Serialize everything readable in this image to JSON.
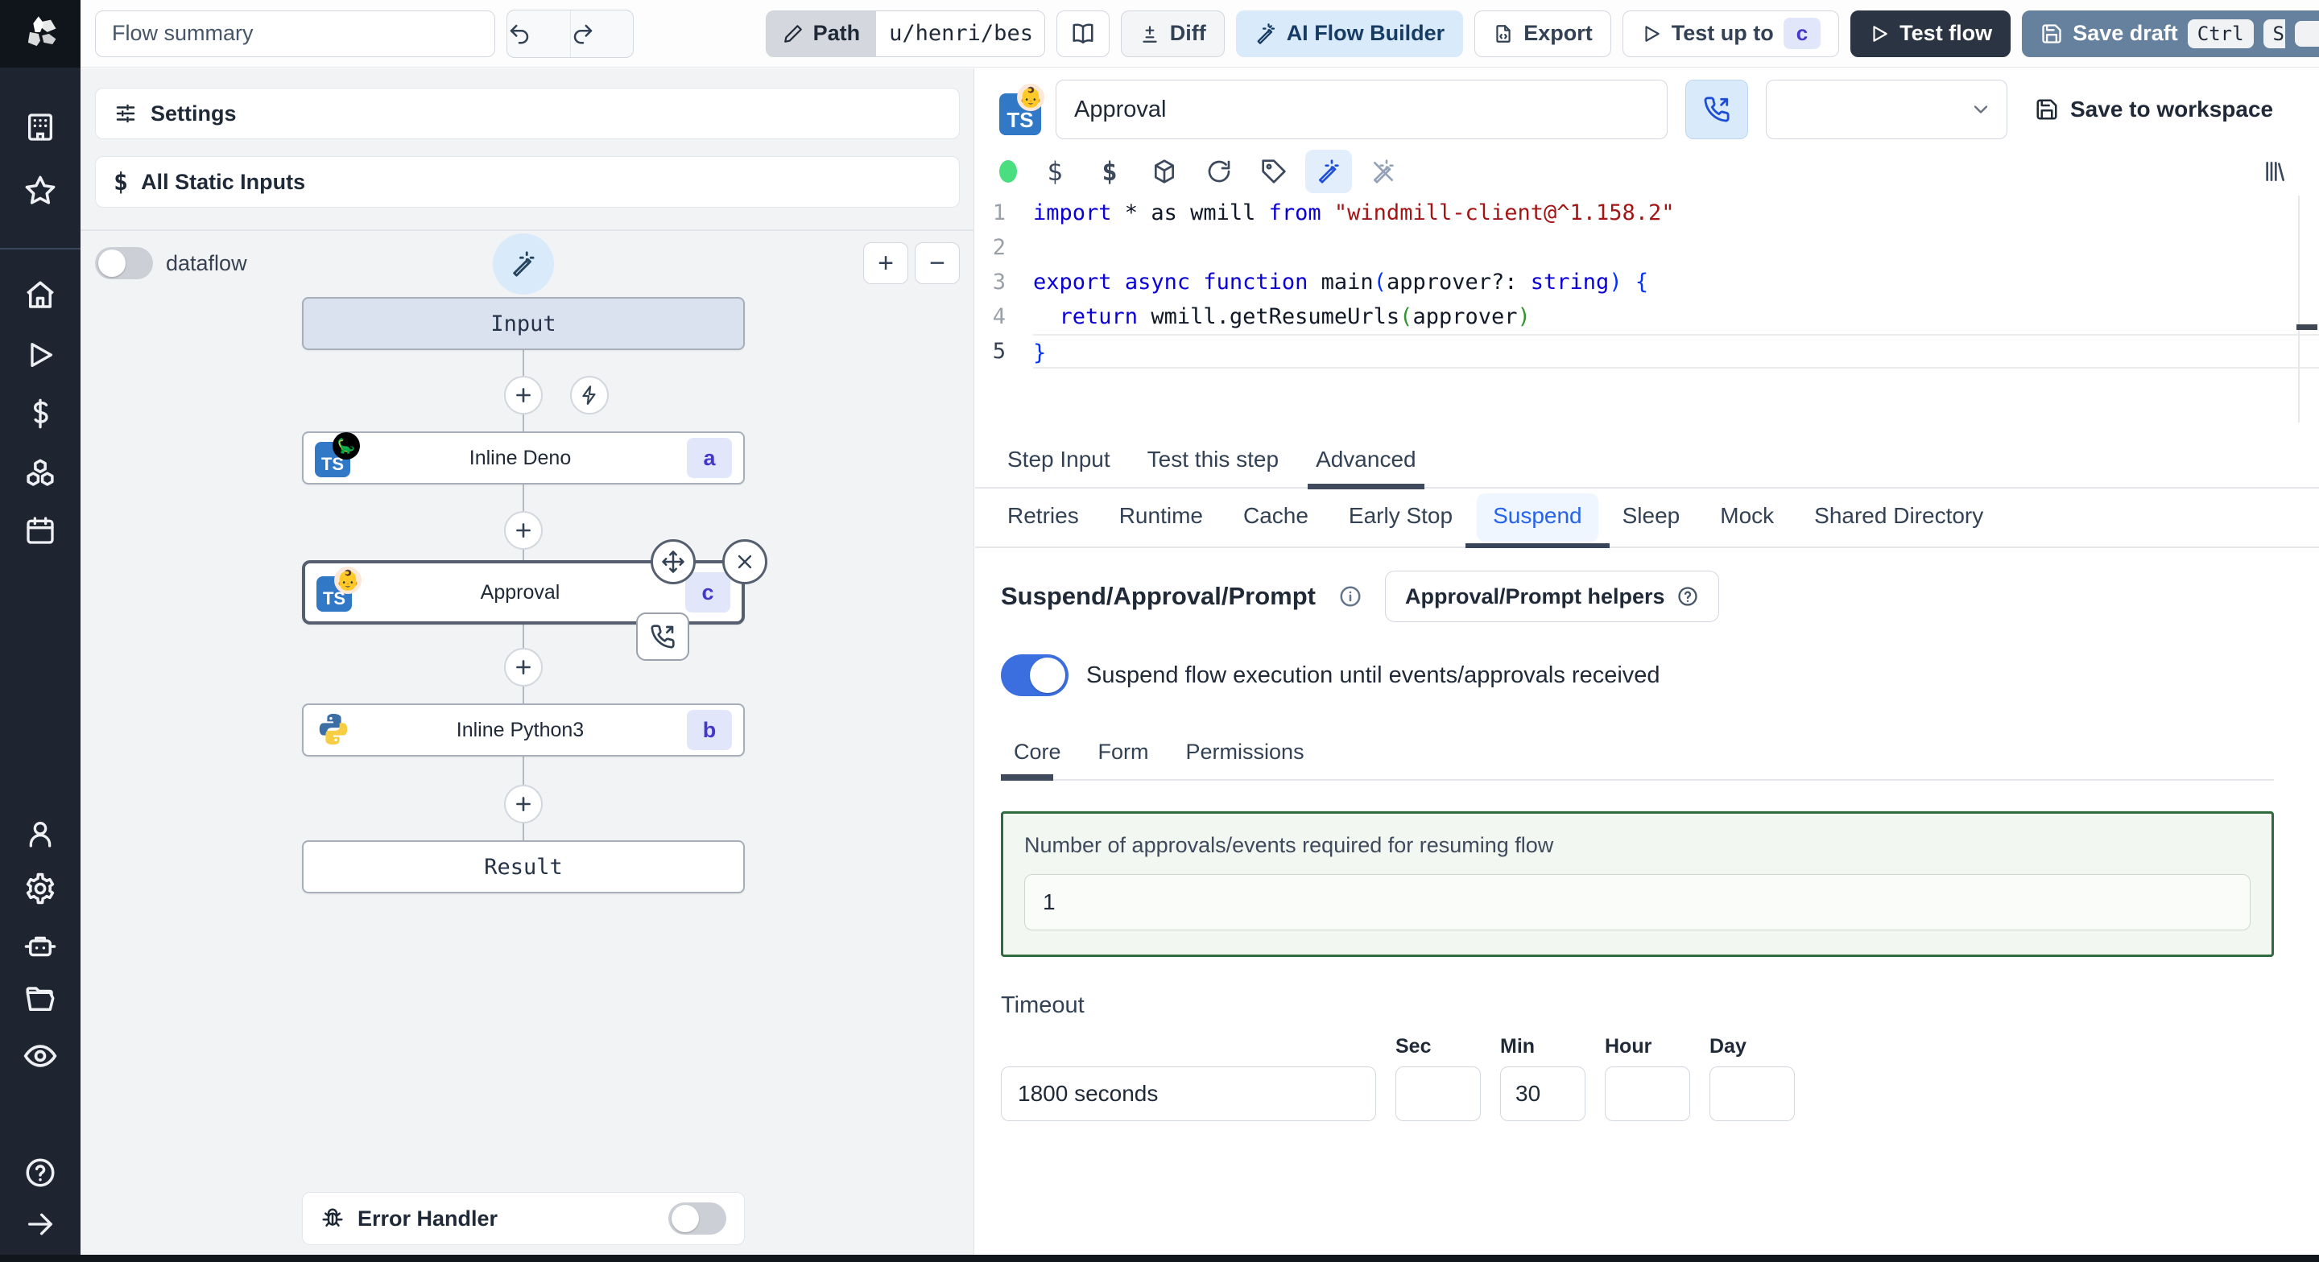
{
  "colors": {
    "rail_bg": "#1f2530",
    "accent_blue": "#2563eb",
    "toggle_on": "#3b6fe0",
    "badge_bg": "#e2e6fb",
    "badge_text": "#4338ca",
    "dark_button": "#2b3442",
    "slate_button": "#66819e",
    "ai_button_bg": "#d9eafb",
    "green_border": "#2f6b3f",
    "status_dot": "#4ade80",
    "selected_node_border": "#555f70"
  },
  "rail": {
    "icons": [
      "windmill-logo",
      "workspace-icon",
      "favorites-icon",
      "home-icon",
      "runs-icon",
      "variables-icon",
      "resources-icon",
      "schedules-icon",
      "user-icon",
      "gear-icon",
      "workers-icon",
      "folders-icon",
      "audit-icon",
      "help-icon",
      "collapse-icon"
    ]
  },
  "topbar": {
    "flow_summary_placeholder": "Flow summary",
    "path_label": "Path",
    "path_value": "u/henri/bes",
    "diff_label": "Diff",
    "ai_flow_builder_label": "AI Flow Builder",
    "export_label": "Export",
    "test_up_to_label": "Test up to",
    "test_up_to_badge": "c",
    "test_flow_label": "Test flow",
    "save_draft_label": "Save draft",
    "kbd_ctrl": "Ctrl",
    "kbd_s": "S"
  },
  "left": {
    "settings_label": "Settings",
    "static_inputs_label": "All Static Inputs",
    "dataflow_label": "dataflow",
    "error_handler_label": "Error Handler"
  },
  "graph": {
    "input_label": "Input",
    "steps": [
      {
        "label": "Inline Deno",
        "badge": "a",
        "lang": "deno"
      },
      {
        "label": "Approval",
        "badge": "c",
        "lang": "bun"
      },
      {
        "label": "Inline Python3",
        "badge": "b",
        "lang": "python"
      }
    ],
    "result_label": "Result"
  },
  "step": {
    "name_value": "Approval",
    "save_to_workspace_label": "Save to workspace",
    "code": {
      "lines": [
        {
          "n": "1",
          "tokens": [
            {
              "c": "kw",
              "t": "import"
            },
            {
              "c": "pl",
              "t": " * as wmill "
            },
            {
              "c": "kw",
              "t": "from"
            },
            {
              "c": "str",
              "t": " \"windmill-client@^1.158.2\""
            }
          ]
        },
        {
          "n": "2",
          "tokens": []
        },
        {
          "n": "3",
          "tokens": [
            {
              "c": "kw",
              "t": "export"
            },
            {
              "c": "pl",
              "t": " "
            },
            {
              "c": "kw",
              "t": "async"
            },
            {
              "c": "pl",
              "t": " "
            },
            {
              "c": "kw",
              "t": "function"
            },
            {
              "c": "pl",
              "t": " main"
            },
            {
              "c": "p1",
              "t": "("
            },
            {
              "c": "pl",
              "t": "approver?: "
            },
            {
              "c": "kw",
              "t": "string"
            },
            {
              "c": "p1",
              "t": ")"
            },
            {
              "c": "pl",
              "t": " "
            },
            {
              "c": "p1",
              "t": "{"
            }
          ]
        },
        {
          "n": "4",
          "tokens": [
            {
              "c": "pl",
              "t": "  "
            },
            {
              "c": "kw",
              "t": "return"
            },
            {
              "c": "pl",
              "t": " wmill.getResumeUrls"
            },
            {
              "c": "p2",
              "t": "("
            },
            {
              "c": "pl",
              "t": "approver"
            },
            {
              "c": "p2",
              "t": ")"
            }
          ]
        },
        {
          "n": "5",
          "current": true,
          "tokens": [
            {
              "c": "p1",
              "t": "}"
            }
          ]
        }
      ]
    },
    "tabs": [
      {
        "label": "Step Input",
        "active": false
      },
      {
        "label": "Test this step",
        "active": false
      },
      {
        "label": "Advanced",
        "active": true
      }
    ],
    "subtabs": [
      {
        "label": "Retries",
        "active": false
      },
      {
        "label": "Runtime",
        "active": false
      },
      {
        "label": "Cache",
        "active": false
      },
      {
        "label": "Early Stop",
        "active": false
      },
      {
        "label": "Suspend",
        "active": true
      },
      {
        "label": "Sleep",
        "active": false
      },
      {
        "label": "Mock",
        "active": false
      },
      {
        "label": "Shared Directory",
        "active": false
      }
    ],
    "suspend": {
      "title": "Suspend/Approval/Prompt",
      "helpers_button_label": "Approval/Prompt helpers",
      "toggle_label": "Suspend flow execution until events/approvals received",
      "toggle_on": true,
      "tabs": [
        {
          "label": "Core",
          "active": true
        },
        {
          "label": "Form",
          "active": false
        },
        {
          "label": "Permissions",
          "active": false
        }
      ],
      "approvals_label": "Number of approvals/events required for resuming flow",
      "approvals_value": "1",
      "timeout_label": "Timeout",
      "timeout_value": "1800 seconds",
      "units": [
        {
          "label": "Sec",
          "value": ""
        },
        {
          "label": "Min",
          "value": "30"
        },
        {
          "label": "Hour",
          "value": ""
        },
        {
          "label": "Day",
          "value": ""
        }
      ]
    }
  }
}
